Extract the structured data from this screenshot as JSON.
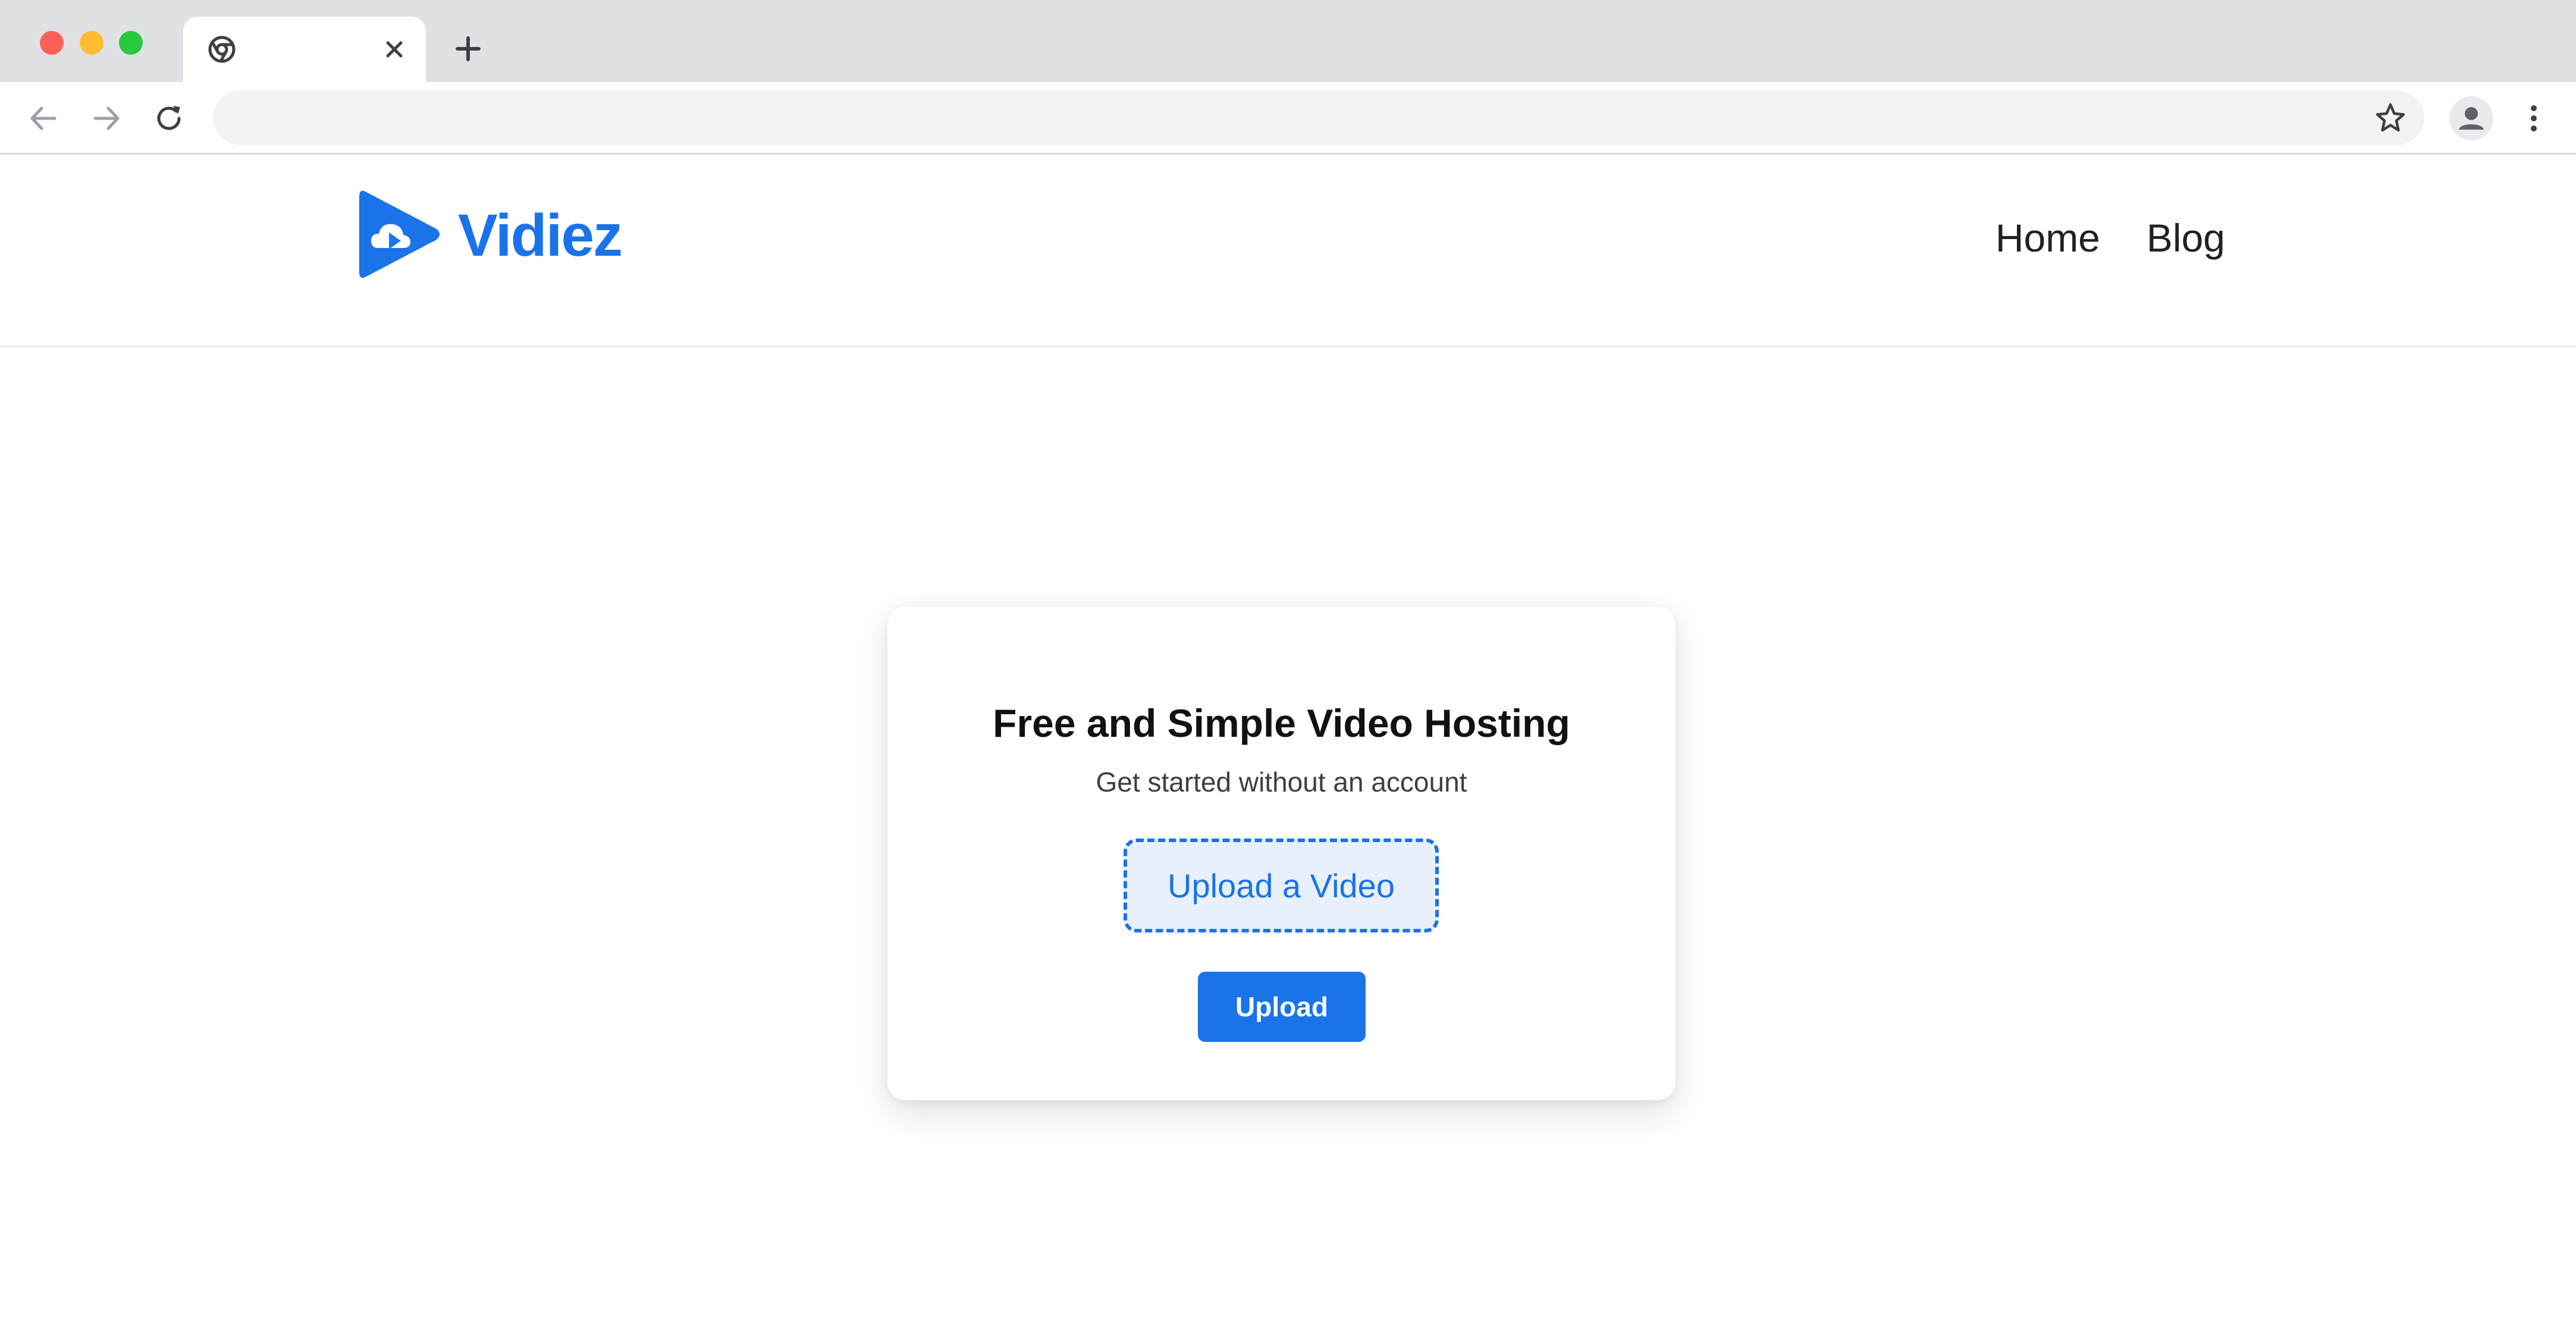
{
  "browser": {
    "tab": {
      "title": ""
    },
    "address_bar": {
      "value": "",
      "placeholder": ""
    }
  },
  "site": {
    "logo_text": "Vidiez",
    "brand_color": "#1a73e8",
    "nav": [
      {
        "label": "Home"
      },
      {
        "label": "Blog"
      }
    ]
  },
  "card": {
    "title": "Free and Simple Video Hosting",
    "subtitle": "Get started without an account",
    "upload_zone_label": "Upload a Video",
    "upload_button_label": "Upload"
  },
  "icons": {
    "favicon": "chrome-icon",
    "tab_close": "close-icon",
    "new_tab": "plus-icon",
    "back": "arrow-left-icon",
    "forward": "arrow-right-icon",
    "reload": "reload-icon",
    "bookmark": "star-icon",
    "profile": "avatar-icon",
    "menu": "vertical-dots-icon",
    "logo": "cloud-play-icon"
  }
}
